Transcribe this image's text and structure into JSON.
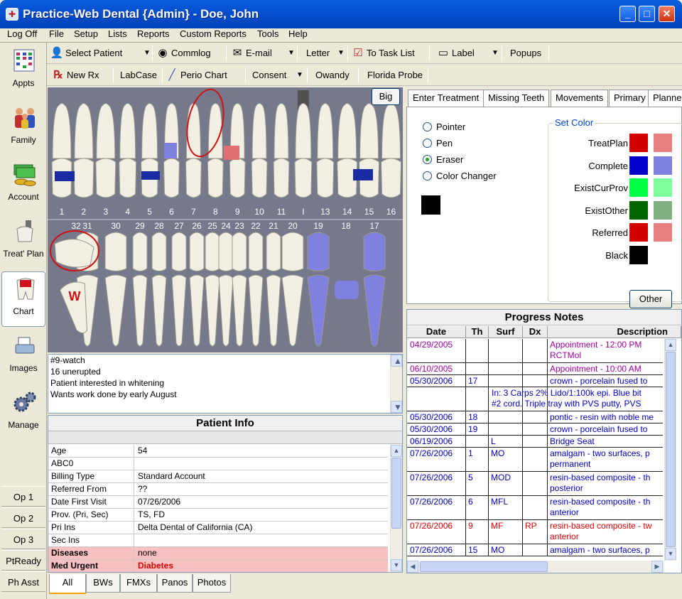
{
  "window": {
    "title": "Practice-Web Dental {Admin} - Doe, John"
  },
  "menu": [
    "Log Off",
    "File",
    "Setup",
    "Lists",
    "Reports",
    "Custom Reports",
    "Tools",
    "Help"
  ],
  "sidebar": {
    "modules": [
      {
        "label": "Appts",
        "icon": "calendar-icon"
      },
      {
        "label": "Family",
        "icon": "family-icon"
      },
      {
        "label": "Account",
        "icon": "money-icon"
      },
      {
        "label": "Treat' Plan",
        "icon": "treatment-plan-icon"
      },
      {
        "label": "Chart",
        "icon": "tooth-chart-icon"
      },
      {
        "label": "Images",
        "icon": "scanner-icon"
      },
      {
        "label": "Manage",
        "icon": "gears-icon"
      }
    ],
    "ops": [
      "Op 1",
      "Op 2",
      "Op 3",
      "PtReady",
      "Ph Asst"
    ]
  },
  "toolbar1": {
    "select_patient": "Select Patient",
    "commlog": "Commlog",
    "email": "E-mail",
    "letter": "Letter",
    "task_list": "To Task List",
    "label": "Label",
    "popups": "Popups"
  },
  "toolbar2": {
    "new_rx": "New Rx",
    "labcase": "LabCase",
    "perio_chart": "Perio Chart",
    "consent": "Consent",
    "owandy": "Owandy",
    "florida_probe": "Florida Probe"
  },
  "chart": {
    "big_button": "Big",
    "upper_numbers": [
      "1",
      "2",
      "3",
      "4",
      "5",
      "6",
      "7",
      "8",
      "9",
      "10",
      "11",
      "I",
      "13",
      "14",
      "15",
      "16"
    ],
    "lower_numbers": [
      "32",
      "31",
      "30",
      "29",
      "28",
      "27",
      "26",
      "25",
      "24",
      "23",
      "22",
      "21",
      "20",
      "19",
      "18",
      "17"
    ],
    "colors": {
      "background": "#76798c",
      "restoration": "#1a2aa0",
      "existing": "#8080e0",
      "treatment": "#e07070",
      "circle": "#d01010"
    },
    "annotation_letter": "W"
  },
  "notes": [
    "#9-watch",
    "16 unerupted",
    "Patient interested in whitening",
    "Wants work done by early August"
  ],
  "patient_info": {
    "title": "Patient Info",
    "rows": [
      {
        "key": "Age",
        "value": "54"
      },
      {
        "key": "ABC0",
        "value": ""
      },
      {
        "key": "Billing Type",
        "value": "Standard Account"
      },
      {
        "key": "Referred From",
        "value": "??"
      },
      {
        "key": "Date First Visit",
        "value": "07/26/2006"
      },
      {
        "key": "Prov. (Pri, Sec)",
        "value": "TS, FD"
      },
      {
        "key": "Pri Ins",
        "value": "Delta Dental of California (CA)"
      },
      {
        "key": "Sec Ins",
        "value": ""
      },
      {
        "key": "Diseases",
        "value": "none"
      },
      {
        "key": "Med Urgent",
        "value": "Diabetes"
      }
    ]
  },
  "image_tabs": [
    "All",
    "BWs",
    "FMXs",
    "Panos",
    "Photos"
  ],
  "treatment_tabs": [
    "Enter Treatment",
    "Missing Teeth",
    "Movements",
    "Primary",
    "Planne"
  ],
  "tools": {
    "options": [
      "Pointer",
      "Pen",
      "Eraser",
      "Color Changer"
    ],
    "selected": "Eraser",
    "current_color": "#000000"
  },
  "set_color": {
    "legend": "Set Color",
    "other_button": "Other",
    "rows": [
      {
        "label": "TreatPlan",
        "c1": "#d40000",
        "c2": "#e88080"
      },
      {
        "label": "Complete",
        "c1": "#0000c8",
        "c2": "#8080e0"
      },
      {
        "label": "ExistCurProv",
        "c1": "#00ff40",
        "c2": "#80ff9f"
      },
      {
        "label": "ExistOther",
        "c1": "#006400",
        "c2": "#80b080"
      },
      {
        "label": "Referred",
        "c1": "#d40000",
        "c2": "#e88080"
      },
      {
        "label": "Black",
        "c1": "#000000",
        "c2": ""
      }
    ]
  },
  "progress_notes": {
    "title": "Progress Notes",
    "columns": [
      "Date",
      "Th",
      "Surf",
      "Dx",
      "Description"
    ],
    "rows": [
      {
        "date": "04/29/2005",
        "th": "",
        "surf": "",
        "dx": "",
        "desc": "Appointment - 12:00 PM",
        "desc2": "RCTMol",
        "color": "#a000a0"
      },
      {
        "date": "06/10/2005",
        "th": "",
        "surf": "",
        "dx": "",
        "desc": "Appointment - 10:00 AM",
        "desc2": "",
        "color": "#a000a0"
      },
      {
        "date": "05/30/2006",
        "th": "17",
        "surf": "",
        "dx": "",
        "desc": "crown - porcelain fused to",
        "desc2": "",
        "color": "#0000c8"
      },
      {
        "date": "",
        "th": "",
        "surf": "",
        "dx": "",
        "desc": "In: 3 Carps 2% Lido/1:100k epi. Blue bit",
        "desc2": "#2 cord. Triple tray with PVS putty, PVS",
        "color": "#0000c8",
        "wide": true
      },
      {
        "date": "05/30/2006",
        "th": "18",
        "surf": "",
        "dx": "",
        "desc": "pontic - resin with noble me",
        "desc2": "",
        "color": "#0000c8"
      },
      {
        "date": "05/30/2006",
        "th": "19",
        "surf": "",
        "dx": "",
        "desc": "crown - porcelain fused to",
        "desc2": "",
        "color": "#0000c8"
      },
      {
        "date": "06/19/2006",
        "th": "",
        "surf": "L",
        "dx": "",
        "desc": "Bridge Seat",
        "desc2": "",
        "color": "#0000c8"
      },
      {
        "date": "07/26/2006",
        "th": "1",
        "surf": "MO",
        "dx": "",
        "desc": "amalgam - two surfaces, p",
        "desc2": "permanent",
        "color": "#0000c8"
      },
      {
        "date": "07/26/2006",
        "th": "5",
        "surf": "MOD",
        "dx": "",
        "desc": "resin-based composite - th",
        "desc2": "posterior",
        "color": "#0000c8"
      },
      {
        "date": "07/26/2006",
        "th": "6",
        "surf": "MFL",
        "dx": "",
        "desc": "resin-based composite - th",
        "desc2": "anterior",
        "color": "#0000c8"
      },
      {
        "date": "07/26/2006",
        "th": "9",
        "surf": "MF",
        "dx": "RP",
        "desc": "resin-based composite - tw",
        "desc2": "anterior",
        "color": "#e00000"
      },
      {
        "date": "07/26/2006",
        "th": "15",
        "surf": "MO",
        "dx": "",
        "desc": "amalgam - two surfaces, p",
        "desc2": "",
        "color": "#0000c8"
      }
    ]
  }
}
